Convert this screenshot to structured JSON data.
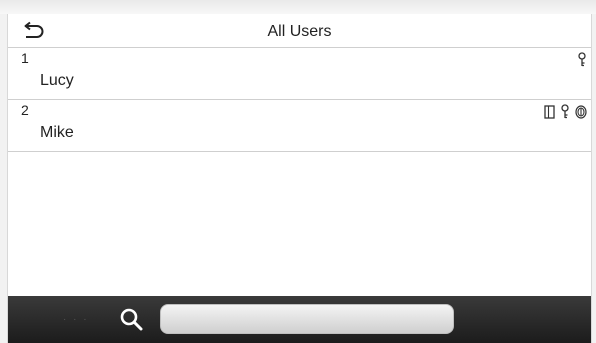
{
  "header": {
    "title": "All Users",
    "back_icon": "undo-arrow-icon"
  },
  "users": [
    {
      "id": "1",
      "name": "Lucy",
      "credential_icons": [
        "key-icon"
      ]
    },
    {
      "id": "2",
      "name": "Mike",
      "credential_icons": [
        "card-icon",
        "key-icon",
        "fingerprint-icon"
      ]
    }
  ],
  "search": {
    "value": "",
    "placeholder": ""
  },
  "colors": {
    "bar_top": "#3a3a3a",
    "bar_bottom": "#1c1c1c",
    "divider": "#cfcfcf"
  }
}
